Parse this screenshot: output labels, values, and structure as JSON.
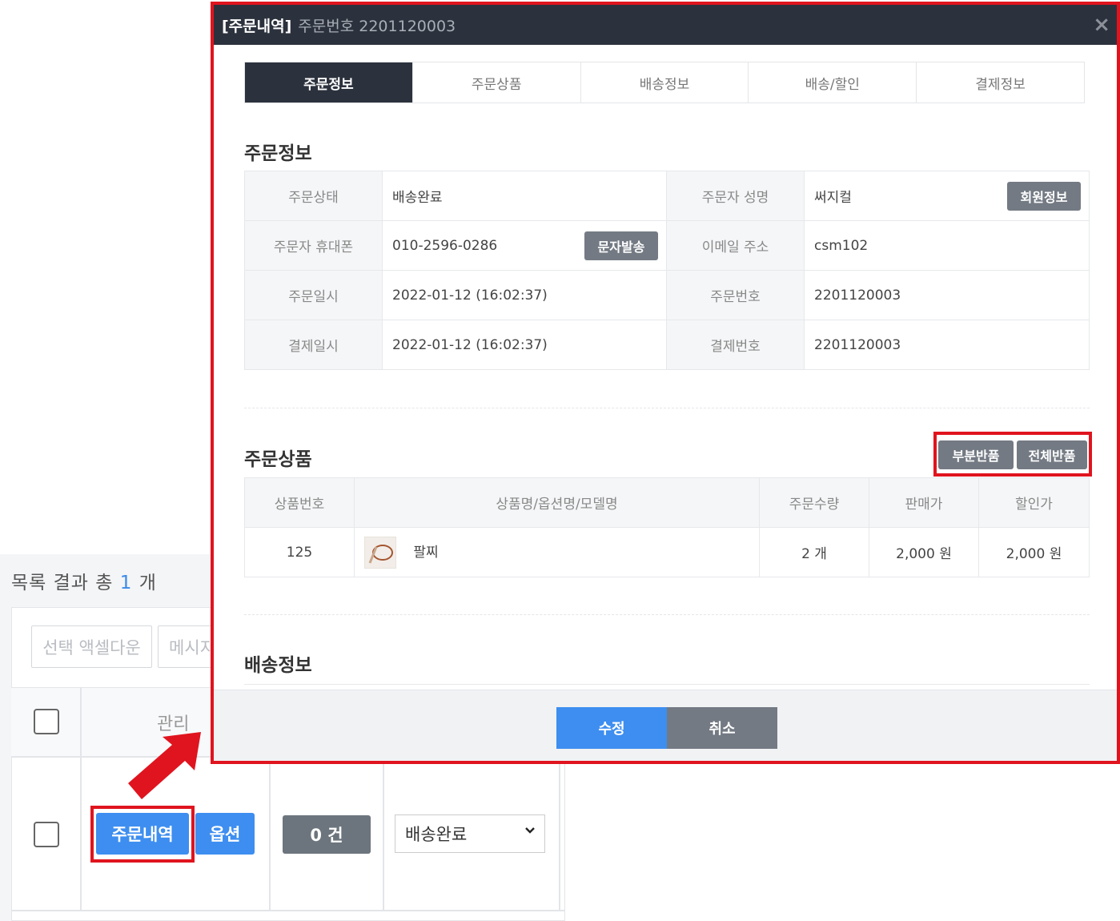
{
  "list": {
    "count_prefix": "목록 결과 총",
    "count_value": "1",
    "count_suffix": "개",
    "excel_button": "선택 액셀다운",
    "message_button": "메시지",
    "manage_header": "관리",
    "row": {
      "order_button": "주문내역",
      "option_button": "옵션",
      "count_badge": "0 건",
      "status_select": "배송완료"
    }
  },
  "modal": {
    "title": "[주문내역]",
    "subtitle": "주문번호 2201120003",
    "close_icon": "×",
    "tabs": [
      "주문정보",
      "주문상품",
      "배송정보",
      "배송/할인",
      "결제정보"
    ],
    "active_tab": "주문정보",
    "order_section": {
      "title": "주문정보",
      "status_label": "주문상태",
      "status_value": "배송완료",
      "name_label": "주문자 성명",
      "name_value": "써지컬",
      "member_button": "회원정보",
      "phone_label": "주문자 휴대폰",
      "phone_value": "010-2596-0286",
      "sms_button": "문자발송",
      "email_label": "이메일 주소",
      "email_value": "csm102",
      "date_label": "주문일시",
      "date_value": "2022-01-12 (16:02:37)",
      "order_no_label": "주문번호",
      "order_no_value": "2201120003",
      "pay_date_label": "결제일시",
      "pay_date_value": "2022-01-12 (16:02:37)",
      "pay_no_label": "결제번호",
      "pay_no_value": "2201120003"
    },
    "product_section": {
      "title": "주문상품",
      "partial_return_button": "부분반품",
      "full_return_button": "전체반품",
      "columns": [
        "상품번호",
        "상품명/옵션명/모델명",
        "주문수량",
        "판매가",
        "할인가"
      ],
      "rows": [
        {
          "no": "125",
          "name": "팔찌",
          "qty": "2 개",
          "price": "2,000 원",
          "discount": "2,000 원"
        }
      ]
    },
    "shipping_section": {
      "title": "배송정보"
    },
    "footer": {
      "save_button": "수정",
      "cancel_button": "취소"
    }
  },
  "colors": {
    "highlight": "#e0141e",
    "primary": "#3d8ef0",
    "header_dark": "#2c323d",
    "button_gray": "#737a83"
  }
}
